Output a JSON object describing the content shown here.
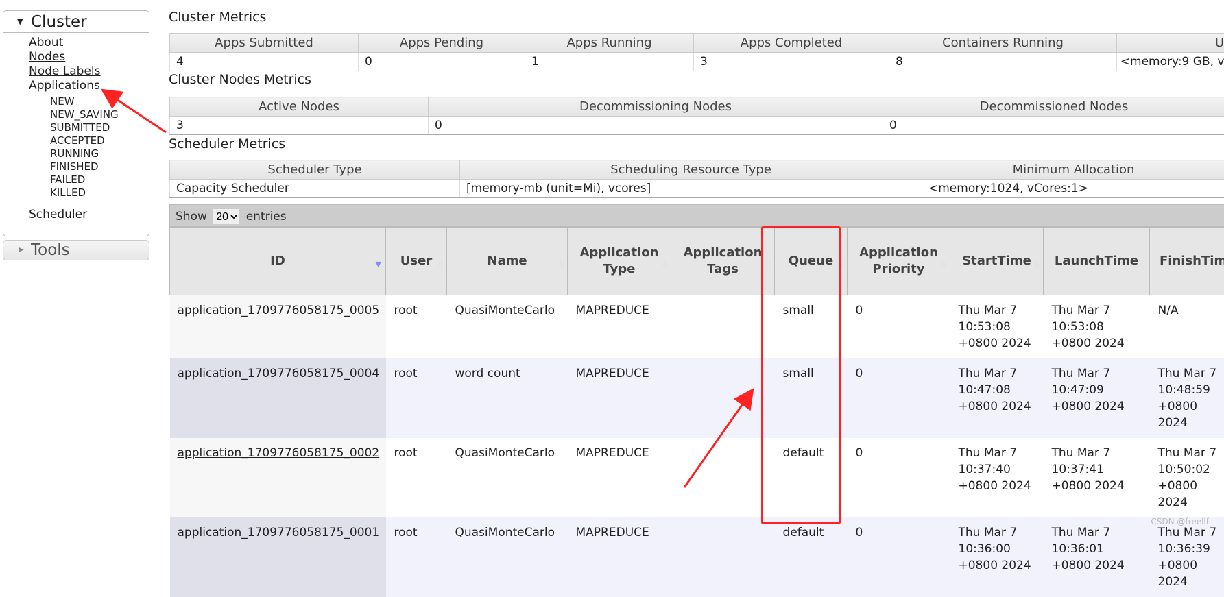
{
  "sidebar": {
    "cluster": "Cluster",
    "links": [
      "About",
      "Nodes",
      "Node Labels",
      "Applications"
    ],
    "states": [
      "NEW",
      "NEW_SAVING",
      "SUBMITTED",
      "ACCEPTED",
      "RUNNING",
      "FINISHED",
      "FAILED",
      "KILLED"
    ],
    "scheduler": "Scheduler",
    "tools": "Tools"
  },
  "cluster_metrics": {
    "title": "Cluster Metrics",
    "headers": [
      "Apps Submitted",
      "Apps Pending",
      "Apps Running",
      "Apps Completed",
      "Containers Running",
      "U"
    ],
    "values": [
      "4",
      "0",
      "1",
      "3",
      "8",
      "<memory:9 GB, v"
    ]
  },
  "nodes_metrics": {
    "title": "Cluster Nodes Metrics",
    "headers": [
      "Active Nodes",
      "Decommissioning Nodes",
      "Decommissioned Nodes"
    ],
    "values": [
      "3",
      "0",
      "0"
    ]
  },
  "scheduler_metrics": {
    "title": "Scheduler Metrics",
    "headers": [
      "Scheduler Type",
      "Scheduling Resource Type",
      "Minimum Allocation"
    ],
    "values": [
      "Capacity Scheduler",
      "[memory-mb (unit=Mi), vcores]",
      "<memory:1024, vCores:1>"
    ]
  },
  "entries": {
    "show": "Show",
    "value": "20",
    "suffix": "entries"
  },
  "apps": {
    "headers": [
      "ID",
      "User",
      "Name",
      "Application Type",
      "Application Tags",
      "Queue",
      "Application Priority",
      "StartTime",
      "LaunchTime",
      "FinishTim"
    ],
    "rows": [
      [
        "application_1709776058175_0005",
        "root",
        "QuasiMonteCarlo",
        "MAPREDUCE",
        "",
        "small",
        "0",
        "Thu Mar 7 10:53:08 +0800 2024",
        "Thu Mar 7 10:53:08 +0800 2024",
        "N/A"
      ],
      [
        "application_1709776058175_0004",
        "root",
        "word count",
        "MAPREDUCE",
        "",
        "small",
        "0",
        "Thu Mar 7 10:47:08 +0800 2024",
        "Thu Mar 7 10:47:09 +0800 2024",
        "Thu Mar 7 10:48:59 +0800 2024"
      ],
      [
        "application_1709776058175_0002",
        "root",
        "QuasiMonteCarlo",
        "MAPREDUCE",
        "",
        "default",
        "0",
        "Thu Mar 7 10:37:40 +0800 2024",
        "Thu Mar 7 10:37:41 +0800 2024",
        "Thu Mar 7 10:50:02 +0800 2024"
      ],
      [
        "application_1709776058175_0001",
        "root",
        "QuasiMonteCarlo",
        "MAPREDUCE",
        "",
        "default",
        "0",
        "Thu Mar 7 10:36:00 +0800 2024",
        "Thu Mar 7 10:36:01 +0800 2024",
        "Thu Mar 7 10:36:39 +0800 2024"
      ]
    ]
  },
  "annotation_color": "#ff2222",
  "watermark": "CSDN @freellf"
}
